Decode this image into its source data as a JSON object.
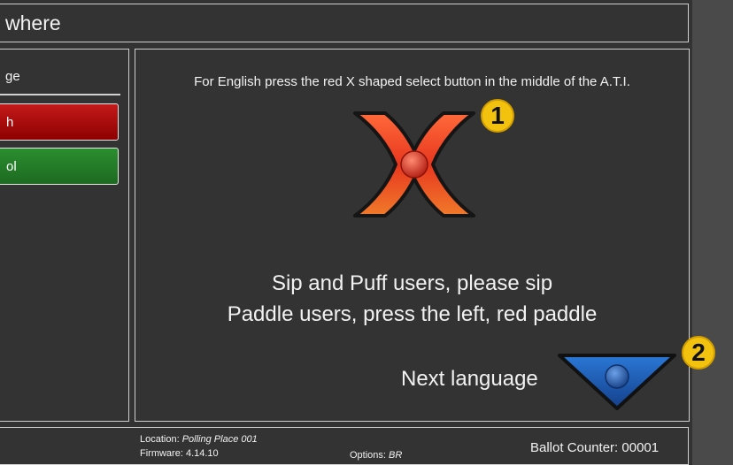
{
  "header": {
    "title": "where"
  },
  "sidebar": {
    "heading": "ge",
    "buttons": [
      {
        "label": "h",
        "color": "#b30f0f"
      },
      {
        "label": "ol",
        "color": "#25802a"
      }
    ]
  },
  "main": {
    "instruction": "For English press the red X shaped select button in the middle of the A.T.I.",
    "select_button_icon": "x-select-button-icon",
    "badge_1": "1",
    "sip_puff_text": "Sip and Puff users, please sip",
    "paddle_text": "Paddle users, press the left, red paddle",
    "next_language_label": "Next language",
    "down_button_icon": "down-arrow-button-icon",
    "badge_2": "2"
  },
  "footer": {
    "location_label": "Location:",
    "location_value": "Polling Place 001",
    "firmware_label": "Firmware:",
    "firmware_value": "4.14.10",
    "options_label": "Options:",
    "options_value": "BR",
    "ballot_counter_label": "Ballot Counter:",
    "ballot_counter_value": "00001"
  },
  "colors": {
    "background": "#333333",
    "x_button": "#e8371f",
    "down_button": "#1f5fb5",
    "badge": "#f2c20f"
  }
}
